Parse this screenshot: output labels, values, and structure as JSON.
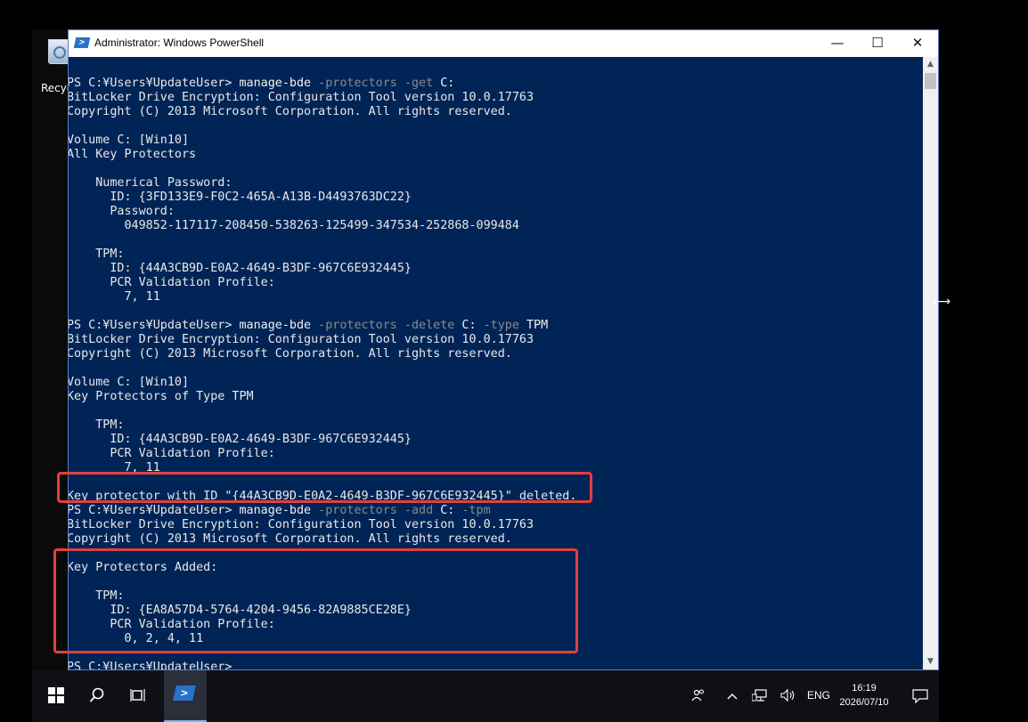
{
  "desktop": {
    "recycle_label": "Recycle Bin"
  },
  "window": {
    "title": "Administrator: Windows PowerShell",
    "controls": {
      "minimize": "—",
      "maximize": "☐",
      "close": "✕"
    }
  },
  "console": {
    "lines": [
      {
        "prompt": "PS C:¥Users¥UpdateUser> ",
        "cmd": "manage-bde",
        "args": [
          " -protectors -get",
          " C:"
        ],
        "kinds": [
          "arg",
          "val"
        ]
      },
      {
        "text": "BitLocker Drive Encryption: Configuration Tool version 10.0.17763"
      },
      {
        "text": "Copyright (C) 2013 Microsoft Corporation. All rights reserved."
      },
      {
        "text": ""
      },
      {
        "text": "Volume C: [Win10]"
      },
      {
        "text": "All Key Protectors"
      },
      {
        "text": ""
      },
      {
        "text": "    Numerical Password:"
      },
      {
        "text": "      ID: {3FD133E9-F0C2-465A-A13B-D4493763DC22}"
      },
      {
        "text": "      Password:"
      },
      {
        "text": "        049852-117117-208450-538263-125499-347534-252868-099484"
      },
      {
        "text": ""
      },
      {
        "text": "    TPM:"
      },
      {
        "text": "      ID: {44A3CB9D-E0A2-4649-B3DF-967C6E932445}"
      },
      {
        "text": "      PCR Validation Profile:"
      },
      {
        "text": "        7, 11"
      },
      {
        "text": ""
      },
      {
        "prompt": "PS C:¥Users¥UpdateUser> ",
        "cmd": "manage-bde",
        "args": [
          " -protectors -delete",
          " C:",
          " -type",
          " TPM"
        ],
        "kinds": [
          "arg",
          "val",
          "arg",
          "val"
        ]
      },
      {
        "text": "BitLocker Drive Encryption: Configuration Tool version 10.0.17763"
      },
      {
        "text": "Copyright (C) 2013 Microsoft Corporation. All rights reserved."
      },
      {
        "text": ""
      },
      {
        "text": "Volume C: [Win10]"
      },
      {
        "text": "Key Protectors of Type TPM"
      },
      {
        "text": ""
      },
      {
        "text": "    TPM:"
      },
      {
        "text": "      ID: {44A3CB9D-E0A2-4649-B3DF-967C6E932445}"
      },
      {
        "text": "      PCR Validation Profile:"
      },
      {
        "text": "        7, 11"
      },
      {
        "text": ""
      },
      {
        "text": "Key protector with ID \"{44A3CB9D-E0A2-4649-B3DF-967C6E932445}\" deleted."
      },
      {
        "prompt": "PS C:¥Users¥UpdateUser> ",
        "cmd": "manage-bde",
        "args": [
          " -protectors -add",
          " C:",
          " -tpm"
        ],
        "kinds": [
          "arg",
          "val",
          "arg"
        ]
      },
      {
        "text": "BitLocker Drive Encryption: Configuration Tool version 10.0.17763"
      },
      {
        "text": "Copyright (C) 2013 Microsoft Corporation. All rights reserved."
      },
      {
        "text": ""
      },
      {
        "text": "Key Protectors Added:"
      },
      {
        "text": ""
      },
      {
        "text": "    TPM:"
      },
      {
        "text": "      ID: {EA8A57D4-5764-4204-9456-82A9885CE28E}"
      },
      {
        "text": "      PCR Validation Profile:"
      },
      {
        "text": "        0, 2, 4, 11"
      },
      {
        "text": ""
      },
      {
        "text": "PS C:¥Users¥UpdateUser>"
      }
    ]
  },
  "taskbar": {
    "start_icon": "windows-logo-icon",
    "search_icon": "search-icon",
    "taskview_icon": "task-view-icon",
    "app_icon": "powershell-icon",
    "tray": {
      "lang": "ENG",
      "time": "16:19",
      "date": "2026/07/10"
    }
  },
  "colors": {
    "console_bg": "#012456",
    "console_fg": "#e8e8e8",
    "arg": "#8a8a8a",
    "highlight": "#e04040"
  }
}
